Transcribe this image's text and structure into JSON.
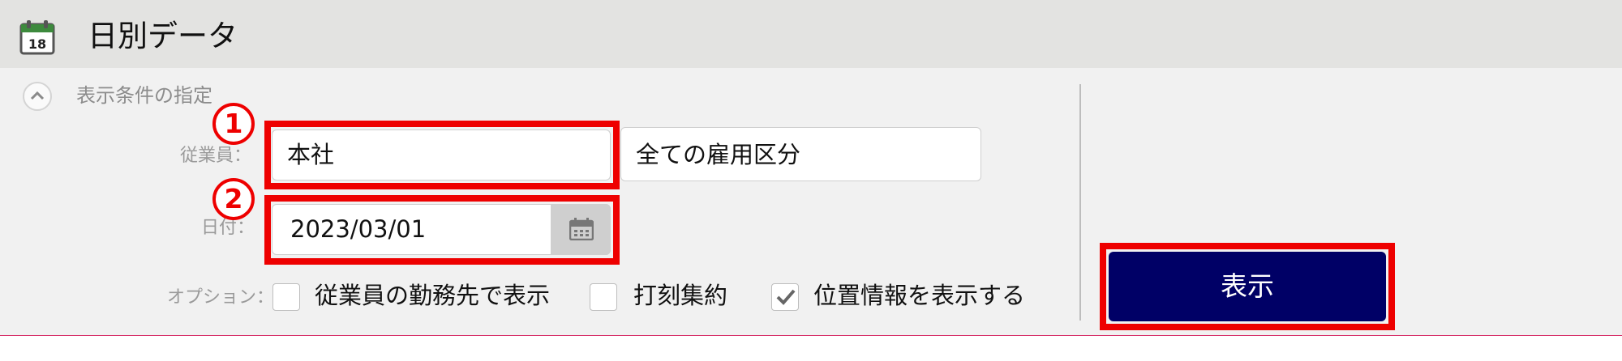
{
  "header": {
    "title": "日別データ",
    "calendar_icon_day": "18"
  },
  "conditions": {
    "section_title": "表示条件の指定",
    "employee_label": "従業員：",
    "employee_value": "本社",
    "employment_type_value": "全ての雇用区分",
    "date_label": "日付：",
    "date_value": "2023/03/01",
    "options_label": "オプション：",
    "options": [
      {
        "label": "従業員の勤務先で表示",
        "checked": false
      },
      {
        "label": "打刻集約",
        "checked": false
      },
      {
        "label": "位置情報を表示する",
        "checked": true
      }
    ]
  },
  "show_button": {
    "label": "表示"
  },
  "markers": [
    "1",
    "2"
  ],
  "colors": {
    "accent_red": "#ee0000",
    "button_navy": "#000066",
    "header_bg": "#e3e3e1",
    "panel_bg": "#f1f1f1"
  }
}
